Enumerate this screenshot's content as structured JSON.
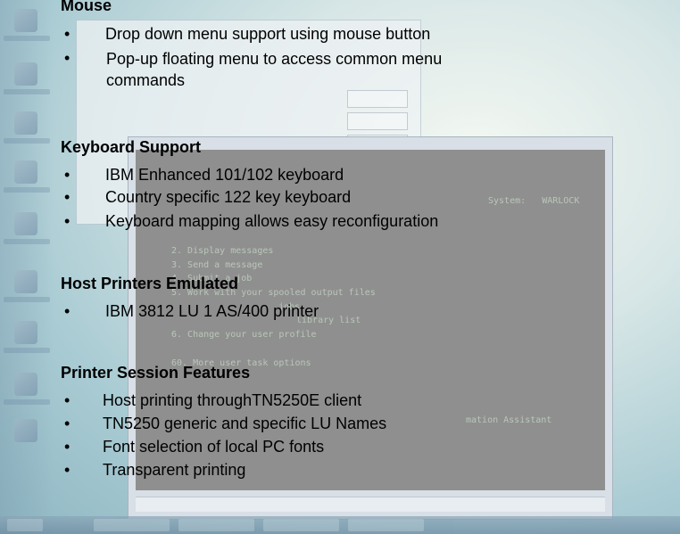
{
  "sections": {
    "mouse": {
      "title": "Mouse",
      "items": [
        "Drop down menu support using mouse button",
        "Pop-up floating menu to access common menu commands"
      ]
    },
    "keyboard": {
      "title": "Keyboard Support",
      "items": [
        "IBM Enhanced 101/102 keyboard",
        "Country specific 122 key keyboard",
        "Keyboard mapping allows easy reconfiguration"
      ]
    },
    "host_printers": {
      "title": "Host Printers Emulated",
      "items": [
        "IBM 3812 LU 1 AS/400 printer"
      ]
    },
    "printer_session": {
      "title": "Printer Session Features",
      "items": [
        "Host printing throughTN5250E client",
        "TN5250 generic and specific LU Names",
        "Font selection of local PC fonts",
        "Transparent printing"
      ]
    }
  },
  "bullet_symbol": "•",
  "background": {
    "terminal_lines": [
      "System:   WARLOCK",
      "2. Display messages",
      "3. Send a message",
      "4. Submit a job",
      "5. Work with your spooled output files",
      "jobs",
      "library list",
      "6. Change your user profile",
      "60. More user task options",
      "mation Assistant"
    ]
  }
}
